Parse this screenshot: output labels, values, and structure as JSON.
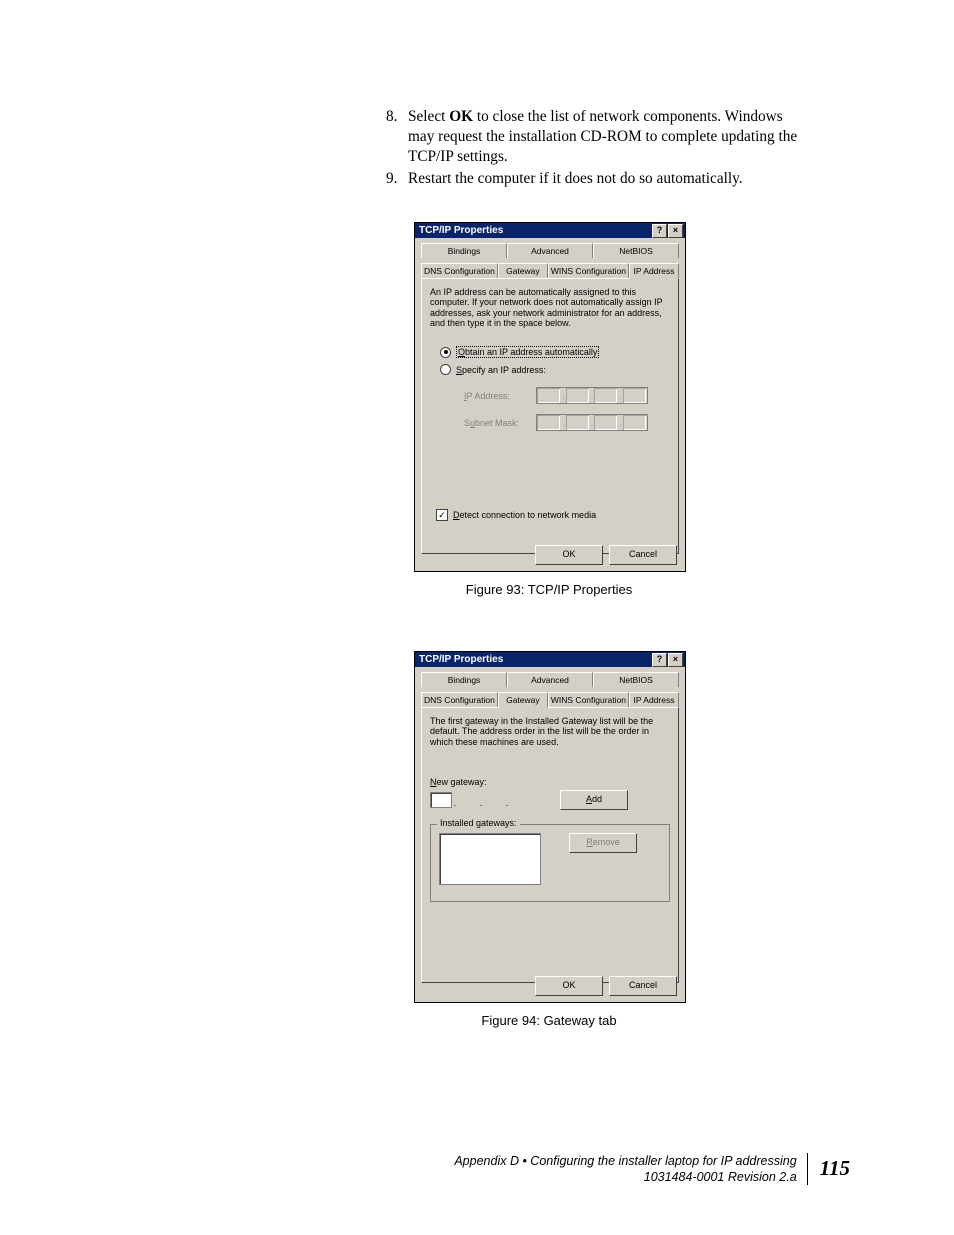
{
  "instructions": {
    "item8_num": "8.",
    "item8_a": "Select ",
    "item8_bold": "OK",
    "item8_b": " to close the list of network components. Windows may request the installation CD-ROM to complete updating the TCP/IP settings.",
    "item9_num": "9.",
    "item9": "Restart the computer if it does not do so automatically."
  },
  "dialog1": {
    "title": "TCP/IP Properties",
    "help_glyph": "?",
    "close_glyph": "×",
    "tabs_row1": [
      "Bindings",
      "Advanced",
      "NetBIOS"
    ],
    "tabs_row2": [
      "DNS Configuration",
      "Gateway",
      "WINS Configuration",
      "IP Address"
    ],
    "active_tab": "IP Address",
    "desc": "An IP address can be automatically assigned to this computer. If your network does not automatically assign IP addresses, ask your network administrator for an address, and then type it in the space below.",
    "radio_auto_pre": "O",
    "radio_auto": "btain an IP address automatically",
    "radio_specify_pre": "S",
    "radio_specify": "pecify an IP address:",
    "ip_address_pre": "I",
    "ip_address_label": "P Address:",
    "subnet_pre": "u",
    "subnet_label_a": "S",
    "subnet_label_b": "bnet Mask:",
    "detect_pre": "D",
    "detect": "etect connection to network media",
    "ok": "OK",
    "cancel": "Cancel"
  },
  "caption1": "Figure 93:  TCP/IP Properties",
  "dialog2": {
    "title": "TCP/IP Properties",
    "help_glyph": "?",
    "close_glyph": "×",
    "tabs_row1": [
      "Bindings",
      "Advanced",
      "NetBIOS"
    ],
    "tabs_row2": [
      "DNS Configuration",
      "Gateway",
      "WINS Configuration",
      "IP Address"
    ],
    "active_tab": "Gateway",
    "desc": "The first gateway in the Installed Gateway list will be the default. The address order in the list will be the order in which these machines are used.",
    "newgw_pre": "N",
    "newgw": "ew gateway:",
    "add_pre": "A",
    "add": "dd",
    "installed": "Installed gateways:",
    "remove_pre": "R",
    "remove": "emove",
    "ok": "OK",
    "cancel": "Cancel"
  },
  "caption2": "Figure 94:  Gateway tab",
  "footer": {
    "line1": "Appendix D • Configuring the installer laptop for IP addressing",
    "line2": "1031484-0001  Revision 2.a",
    "page": "115"
  }
}
